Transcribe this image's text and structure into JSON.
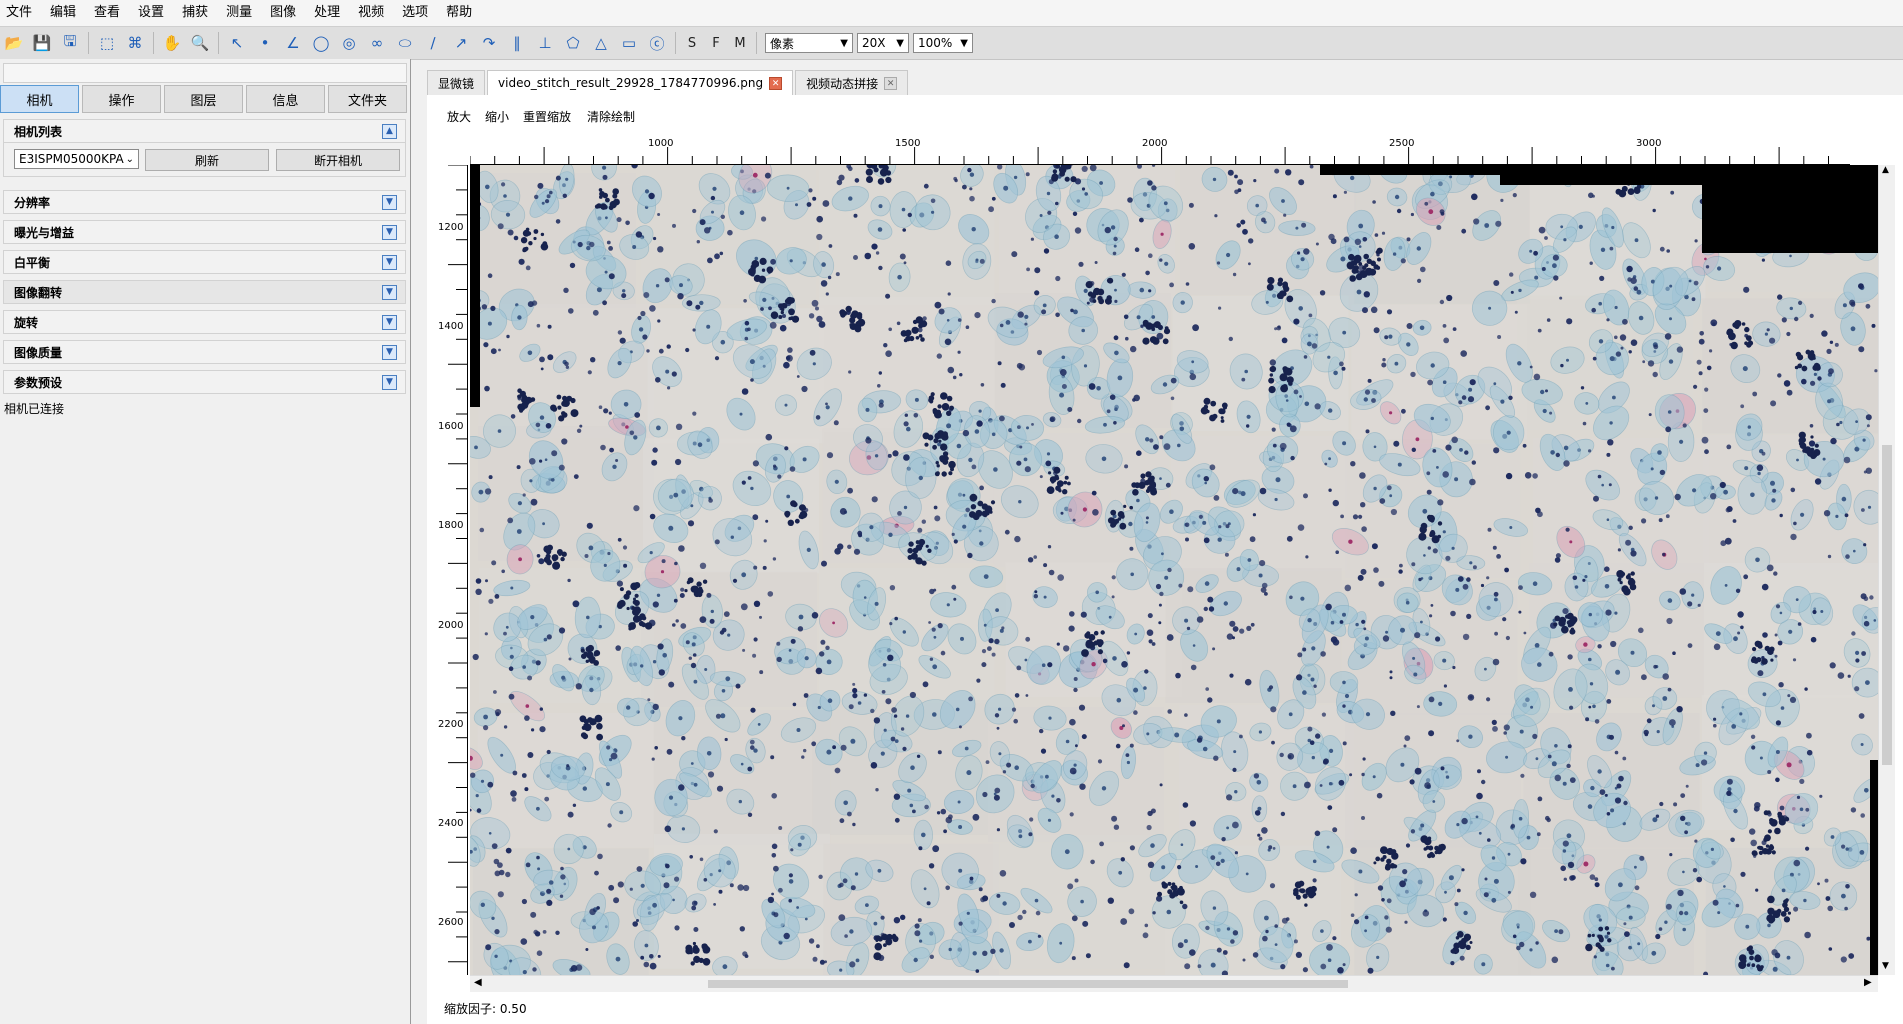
{
  "menu": [
    "文件",
    "编辑",
    "查看",
    "设置",
    "捕获",
    "测量",
    "图像",
    "处理",
    "视频",
    "选项",
    "帮助"
  ],
  "toolbar": {
    "icons": [
      "open-folder-icon",
      "save-icon",
      "save-as-icon",
      "select-rect-icon",
      "crop-icon",
      "hand-icon",
      "zoom-icon",
      "pointer-arrow-icon",
      "point-icon",
      "angle-icon",
      "circle-icon",
      "concentric-circle-icon",
      "link-icon",
      "ellipse-icon",
      "line-icon",
      "arrow-icon",
      "curve-icon",
      "parallel-icon",
      "perpendicular-icon",
      "polygon-icon",
      "triangle-icon",
      "rectangle-icon",
      "text-icon"
    ],
    "letters": [
      "S",
      "F",
      "M"
    ],
    "unit_value": "像素",
    "objective_value": "20X",
    "zoom_value": "100%"
  },
  "left": {
    "tabs": [
      "相机",
      "操作",
      "图层",
      "信息",
      "文件夹"
    ],
    "camera_list_title": "相机列表",
    "camera_select": "E3ISPM05000KPA",
    "refresh_label": "刷新",
    "disconnect_label": "断开相机",
    "sections": [
      "分辨率",
      "曝光与增益",
      "白平衡",
      "图像翻转",
      "旋转",
      "图像质量",
      "参数预设"
    ],
    "status": "相机已连接"
  },
  "doc_tabs": [
    "显微镜",
    "video_stitch_result_29928_1784770996.png",
    "视频动态拼接"
  ],
  "actions": [
    "放大",
    "缩小",
    "重置缩放",
    "清除绘制"
  ],
  "ruler": {
    "h_labels": [
      "1000",
      "1500",
      "2000",
      "2500",
      "3000"
    ],
    "v_labels": [
      "1200",
      "1400",
      "1600",
      "1800",
      "2000",
      "2200",
      "2400",
      "2600"
    ]
  },
  "status_zoom": "缩放因子: 0.50",
  "colors": {
    "accent": "#5b9bd5",
    "cell_blue": "#9fc4d6",
    "nucleus": "#1d2a5e",
    "stain_pink": "#d9a1b6",
    "background_tissue": "#ddd9d4"
  }
}
